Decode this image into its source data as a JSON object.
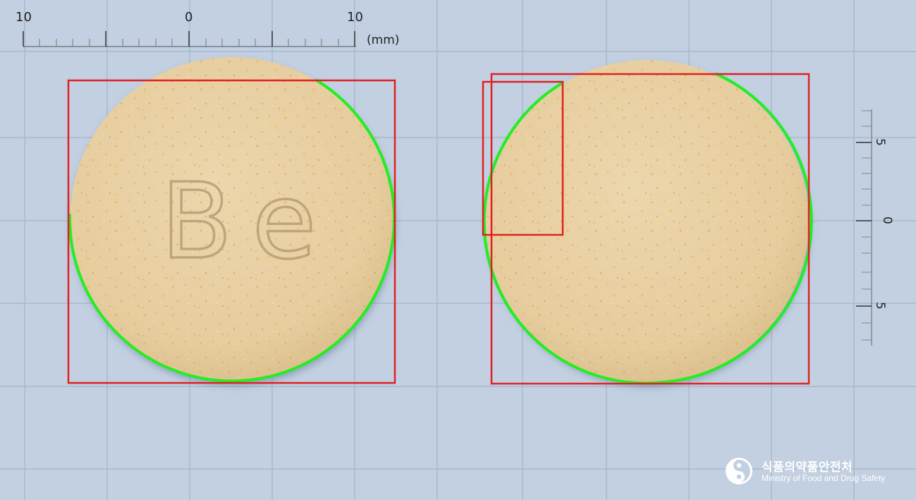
{
  "top_ruler": {
    "labels": [
      "10",
      "0",
      "10"
    ],
    "unit": "(mm)"
  },
  "side_ruler": {
    "labels": [
      "5",
      "0",
      "5"
    ]
  },
  "left_tablet": {
    "imprint": "Be",
    "color": "#e7cfa2"
  },
  "right_tablet": {
    "imprint": "",
    "color": "#e7cfa2"
  },
  "colors": {
    "background": "#c2d0e2",
    "grid": "#a9b8cc",
    "bounding_box": "#e02020",
    "contour": "#22ee22"
  },
  "logo": {
    "korean": "식품의약품안전처",
    "english": "Ministry of Food and Drug Safety"
  }
}
